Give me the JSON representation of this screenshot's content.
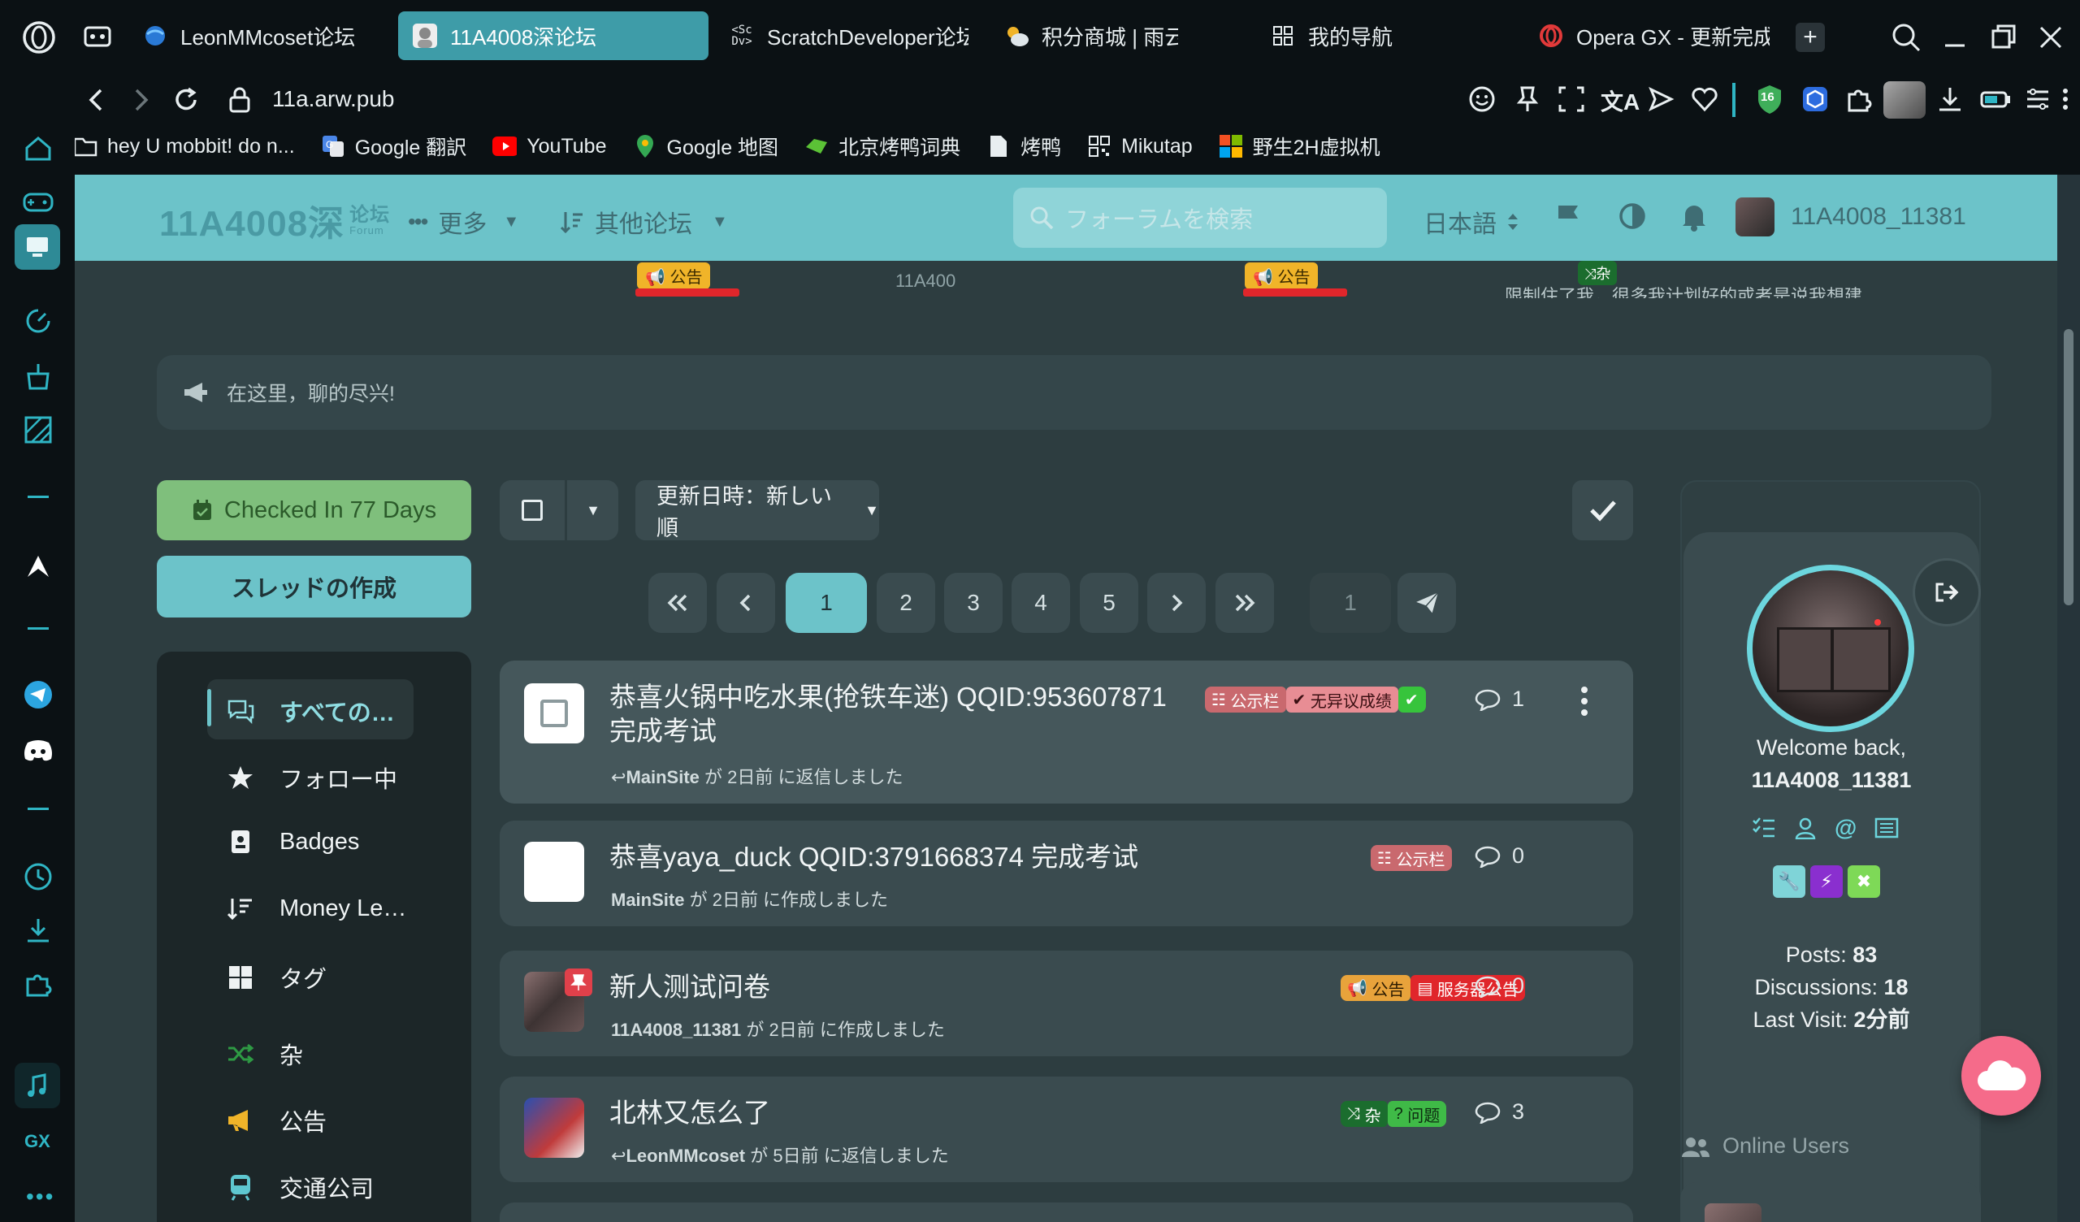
{
  "browser": {
    "tabs": [
      {
        "label": "LeonMMcoset论坛",
        "icon": "globe-icon"
      },
      {
        "label": "11A4008深论坛",
        "icon": "avatar-icon",
        "active": true
      },
      {
        "label": "ScratchDeveloper论坛",
        "icon": "scdv-icon"
      },
      {
        "label": "积分商城 | 雨云",
        "icon": "cloud-sun-icon"
      },
      {
        "label": "我的导航",
        "icon": "grid-icon"
      },
      {
        "label": "Opera GX - 更新完成",
        "icon": "opera-icon"
      }
    ],
    "url": "11a.arw.pub",
    "bookmarks": [
      {
        "label": "hey U mobbit! do n...",
        "icon": "folder-icon"
      },
      {
        "label": "Google 翻訳",
        "icon": "translate-icon"
      },
      {
        "label": "YouTube",
        "icon": "youtube-icon"
      },
      {
        "label": "Google 地图",
        "icon": "maps-icon"
      },
      {
        "label": "北京烤鸭词典",
        "icon": "dict-icon"
      },
      {
        "label": "烤鸭",
        "icon": "doc-icon"
      },
      {
        "label": "Mikutap",
        "icon": "qr-icon"
      },
      {
        "label": "野生2H虚拟机",
        "icon": "windows-icon"
      }
    ],
    "extension_badge": "16",
    "gx_label": "GX"
  },
  "forum": {
    "logo_text": "11A4008深",
    "logo_sub": "论坛",
    "logo_sub2": "Forum",
    "more_label": "更多",
    "other_forums_label": "其他论坛",
    "search_placeholder": "フォーラムを検索",
    "language": "日本語",
    "username": "11A4008_11381"
  },
  "ticker": {
    "items": [
      {
        "tag": "公告",
        "text": ""
      },
      {
        "tag": "",
        "text": "11A400"
      },
      {
        "tag": "公告",
        "text": ""
      },
      {
        "tag": "杂",
        "text": "限制住了我，很多我计划好的或者是说我想建"
      }
    ]
  },
  "announcement": {
    "text": "在这里，聊的尽兴!"
  },
  "actions": {
    "checkin_label": "Checked In 77 Days",
    "new_thread_label": "スレッドの作成",
    "sort_label": "更新日時：新しい順"
  },
  "nav": {
    "items": [
      {
        "label": "すべての…",
        "icon": "comments-icon",
        "active": true
      },
      {
        "label": "フォロー中",
        "icon": "star-icon"
      },
      {
        "label": "Badges",
        "icon": "badge-icon"
      },
      {
        "label": "Money Le…",
        "icon": "sort-icon"
      },
      {
        "label": "タグ",
        "icon": "tags-grid-icon"
      },
      {
        "label": "杂",
        "icon": "shuffle-icon"
      },
      {
        "label": "公告",
        "icon": "megaphone-icon"
      },
      {
        "label": "交通公司",
        "icon": "train-icon"
      }
    ]
  },
  "pagination": {
    "pages": [
      "1",
      "2",
      "3",
      "4",
      "5"
    ],
    "current": "1",
    "jump_value": "1"
  },
  "discussions": [
    {
      "title": "恭喜火锅中吃水果(抢铁车迷)  QQID:953607871 完成考试",
      "author": "MainSite",
      "meta": "が 2日前 に返信しました",
      "replied": true,
      "tags": [
        {
          "label": "公示栏",
          "color": "#c9696e"
        },
        {
          "label": "无异议成绩",
          "color": "#e88d94"
        },
        {
          "label": "",
          "color": "#37c43c"
        }
      ],
      "count": "1"
    },
    {
      "title": "恭喜yaya_duck QQID:3791668374 完成考试",
      "author": "MainSite",
      "meta": "が 2日前 に作成しました",
      "replied": false,
      "tags": [
        {
          "label": "公示栏",
          "color": "#c9696e"
        }
      ],
      "count": "0"
    },
    {
      "title": "新人测试问卷",
      "author": "11A4008_11381",
      "meta": "が 2日前 に作成しました",
      "replied": false,
      "tags": [
        {
          "label": "公告",
          "color": "#e8a33b"
        },
        {
          "label": "服务器公告",
          "color": "#e0262b"
        }
      ],
      "count": "0"
    },
    {
      "title": "北林又怎么了",
      "author": "LeonMMcoset",
      "meta": "が 5日前 に返信しました",
      "replied": true,
      "tags": [
        {
          "label": "杂",
          "color": "#1b6d2e"
        },
        {
          "label": "问题",
          "color": "#3fba47"
        }
      ],
      "count": "3"
    }
  ],
  "profile": {
    "welcome": "Welcome back,",
    "username": "11A4008_11381",
    "posts_label": "Posts:",
    "posts": "83",
    "discussions_label": "Discussions:",
    "discussions": "18",
    "last_visit_label": "Last Visit:",
    "last_visit": "2分前",
    "online_users_label": "Online Users"
  },
  "colors": {
    "accent": "#6cc3c9",
    "page_bg": "#2d3d40",
    "card_bg": "#3a4b4f",
    "checkin_green": "#7fbf7c",
    "float_button": "#f56b8a"
  }
}
